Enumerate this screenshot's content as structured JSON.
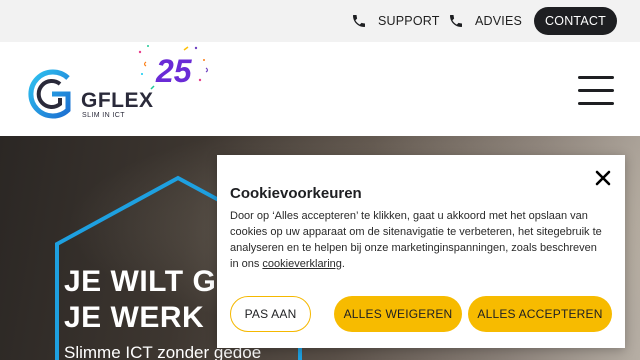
{
  "topbar": {
    "support_label": "SUPPORT",
    "advies_label": "ADVIES",
    "contact_label": "CONTACT",
    "phone_icon": "phone-icon"
  },
  "header": {
    "logo_text": "GFLEX",
    "logo_tagline": "SLIM IN ICT",
    "anniversary_text": "25",
    "menu_icon": "hamburger-menu-icon"
  },
  "hero": {
    "title_line1": "JE WILT G",
    "title_line2": "JE WERK",
    "subtitle": "Slimme ICT zonder gedoe"
  },
  "cookie": {
    "title": "Cookievoorkeuren",
    "body": "Door op ‘Alles accepteren’ te klikken, gaat u akkoord met het opslaan van cookies op uw apparaat om de sitenavigatie te verbeteren, het sitegebruik te analyseren en te helpen bij onze marketinginspanningen, zoals beschreven in ons ",
    "link_text": "cookieverklaring",
    "body_end": ".",
    "btn_customize": "PAS AAN",
    "btn_reject": "ALLES WEIGEREN",
    "btn_accept": "ALLES ACCEPTEREN"
  },
  "colors": {
    "accent_yellow": "#f7bb00",
    "dark": "#1e1f22",
    "logo_blue": "#1ea0e0"
  }
}
